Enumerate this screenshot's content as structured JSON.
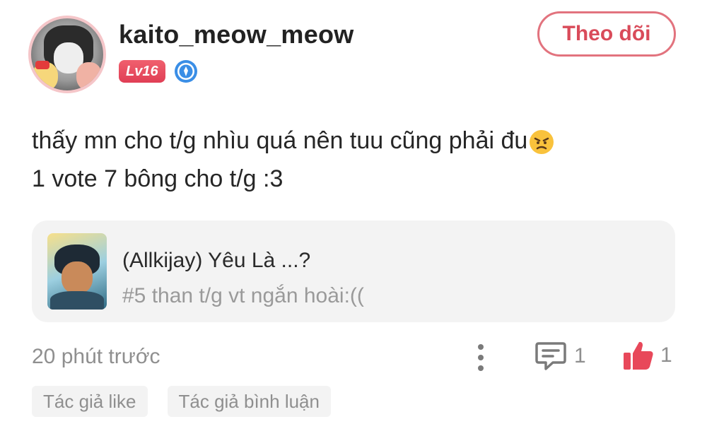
{
  "user": {
    "username": "kaito_meow_meow",
    "level": "Lv16",
    "follow_label": "Theo dõi"
  },
  "post": {
    "line1": "thấy mn cho t/g nhìu quá nên tuu cũng phải đu",
    "line2": "1 vote 7 bông cho t/g :3",
    "emoji": "angry-face-emoji"
  },
  "story": {
    "title": "(Allkijay) Yêu Là ...?",
    "chapter": "#5 than t/g vt ngắn hoài:(("
  },
  "footer": {
    "timestamp": "20 phút trước",
    "comment_count": "1",
    "like_count": "1"
  },
  "tags": [
    "Tác giả like",
    "Tác giả bình luận"
  ],
  "colors": {
    "accent": "#e03e55",
    "verify": "#3a8ee6",
    "muted": "#8f8f8f",
    "card_bg": "#f3f3f3"
  },
  "icons": {
    "verify": "verified-badge-icon",
    "more": "more-vertical-icon",
    "comment": "comment-icon",
    "like": "thumbs-up-icon"
  }
}
